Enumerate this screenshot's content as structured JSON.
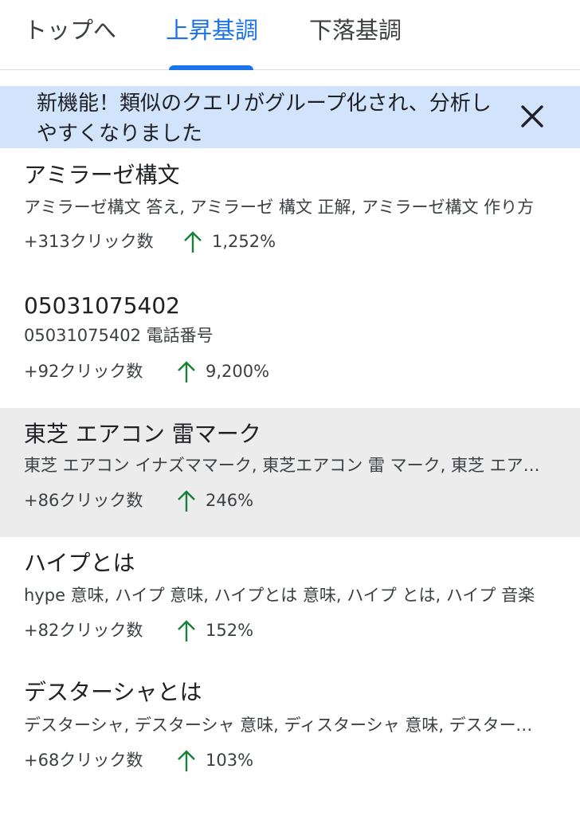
{
  "tabs": [
    {
      "label": "トップへ"
    },
    {
      "label": "上昇基調"
    },
    {
      "label": "下落基調"
    }
  ],
  "active_tab_index": 1,
  "banner": {
    "text": "新機能！類似のクエリがグループ化され、分析しやすくなりました",
    "close_icon": "close-icon"
  },
  "colors": {
    "accent": "#1a73e8",
    "banner_bg": "#d2e3fc",
    "trend_up": "#188038",
    "highlight_row": "#ececec"
  },
  "items": [
    {
      "title": "アミラーゼ構文",
      "subtitle": "アミラーゼ構文 答え, アミラーゼ 構文 正解, アミラーゼ構文 作り方",
      "clicks": "+313クリック数",
      "trend_icon": "arrow-up-icon",
      "change": "1,252%"
    },
    {
      "title": "05031075402",
      "subtitle": "05031075402 電話番号",
      "clicks": "+92クリック数",
      "trend_icon": "arrow-up-icon",
      "change": "9,200%"
    },
    {
      "title": "東芝 エアコン 雷マーク",
      "subtitle": "東芝 エアコン イナズママーク, 東芝エアコン 雷 マーク, 東芝 エアコン 雷",
      "clicks": "+86クリック数",
      "trend_icon": "arrow-up-icon",
      "change": "246%"
    },
    {
      "title": "ハイプとは",
      "subtitle": "hype 意味, ハイプ 意味, ハイプとは 意味, ハイプ とは, ハイプ 音楽",
      "clicks": "+82クリック数",
      "trend_icon": "arrow-up-icon",
      "change": "152%"
    },
    {
      "title": "デスターシャとは",
      "subtitle": "デスターシャ, デスターシャ 意味, ディスターシャ 意味, デスターシャ とは",
      "clicks": "+68クリック数",
      "trend_icon": "arrow-up-icon",
      "change": "103%"
    }
  ]
}
